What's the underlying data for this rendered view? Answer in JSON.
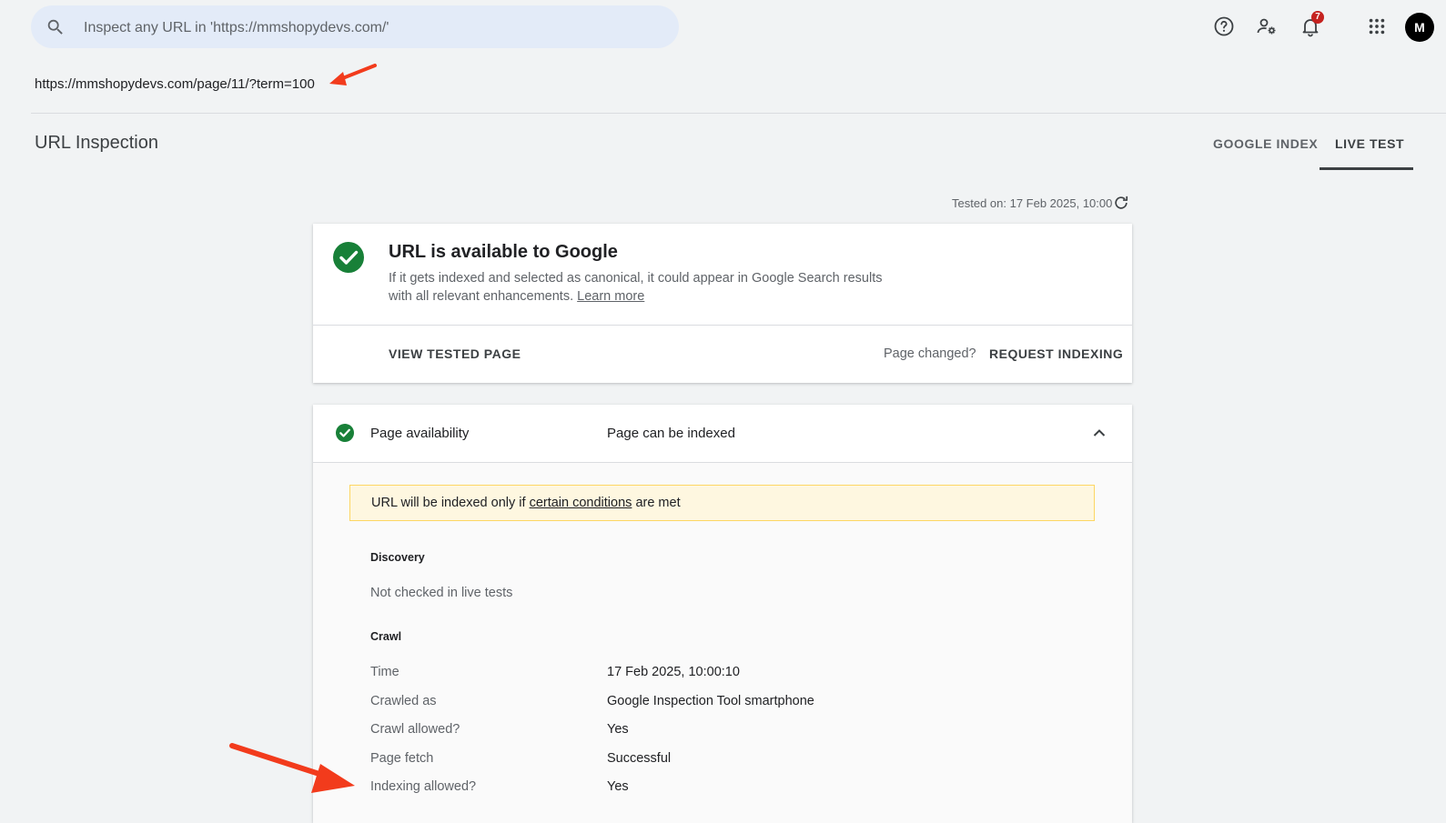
{
  "search": {
    "placeholder": "Inspect any URL in 'https://mmshopydevs.com/'"
  },
  "header_icons": {
    "help": "help-circle-icon",
    "admin": "manage-accounts-icon",
    "notifications": "bell-icon",
    "apps": "apps-grid-icon",
    "notification_count": "7",
    "avatar_text": "M"
  },
  "inspected_url": "https://mmshopydevs.com/page/11/?term=100",
  "page_title": "URL Inspection",
  "tabs": [
    {
      "label": "GOOGLE INDEX",
      "active": false
    },
    {
      "label": "LIVE TEST",
      "active": true
    }
  ],
  "tested_on": "Tested on: 17 Feb 2025, 10:00",
  "result": {
    "title": "URL is available to Google",
    "description_line1": "If it gets indexed and selected as canonical, it could appear in Google Search results",
    "description_line2": "with all relevant enhancements.",
    "learn_more": "Learn more",
    "view_tested_page": "VIEW TESTED PAGE",
    "page_changed": "Page changed?",
    "request_indexing": "REQUEST INDEXING"
  },
  "availability": {
    "label": "Page availability",
    "status": "Page can be indexed",
    "warning_prefix": "URL will be indexed only if",
    "warning_link": "certain conditions",
    "warning_suffix": "are met",
    "discovery_heading": "Discovery",
    "discovery_text": "Not checked in live tests",
    "crawl_heading": "Crawl",
    "crawl_rows": [
      {
        "label": "Time",
        "value": "17 Feb 2025, 10:00:10"
      },
      {
        "label": "Crawled as",
        "value": "Google Inspection Tool smartphone"
      },
      {
        "label": "Crawl allowed?",
        "value": "Yes"
      },
      {
        "label": "Page fetch",
        "value": "Successful"
      },
      {
        "label": "Indexing allowed?",
        "value": "Yes"
      }
    ]
  },
  "colors": {
    "accent_green": "#188038",
    "annotation_arrow": "#f23b1c",
    "warning_bg": "#fef7e0"
  }
}
